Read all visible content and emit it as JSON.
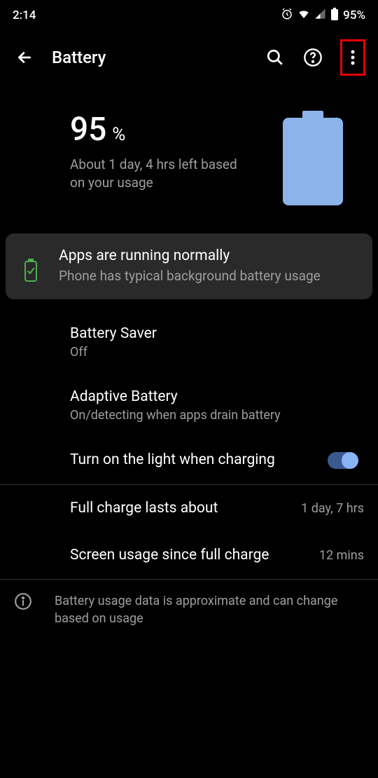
{
  "status_bar": {
    "time": "2:14",
    "battery_pct": "95%"
  },
  "app_bar": {
    "title": "Battery"
  },
  "hero": {
    "percent_value": "95",
    "percent_symbol": "%",
    "estimate": "About 1 day, 4 hrs left based on your usage"
  },
  "status_card": {
    "title": "Apps are running normally",
    "subtitle": "Phone has typical background battery usage"
  },
  "settings": {
    "battery_saver": {
      "title": "Battery Saver",
      "sub": "Off"
    },
    "adaptive_battery": {
      "title": "Adaptive Battery",
      "sub": "On/detecting when apps drain battery"
    },
    "light_charging": {
      "title": "Turn on the light when charging",
      "toggle_on": true
    },
    "full_charge": {
      "title": "Full charge lasts about",
      "value": "1 day, 7 hrs"
    },
    "screen_usage": {
      "title": "Screen usage since full charge",
      "value": "12 mins"
    }
  },
  "footer": {
    "text": "Battery usage data is approximate and can change based on usage"
  }
}
